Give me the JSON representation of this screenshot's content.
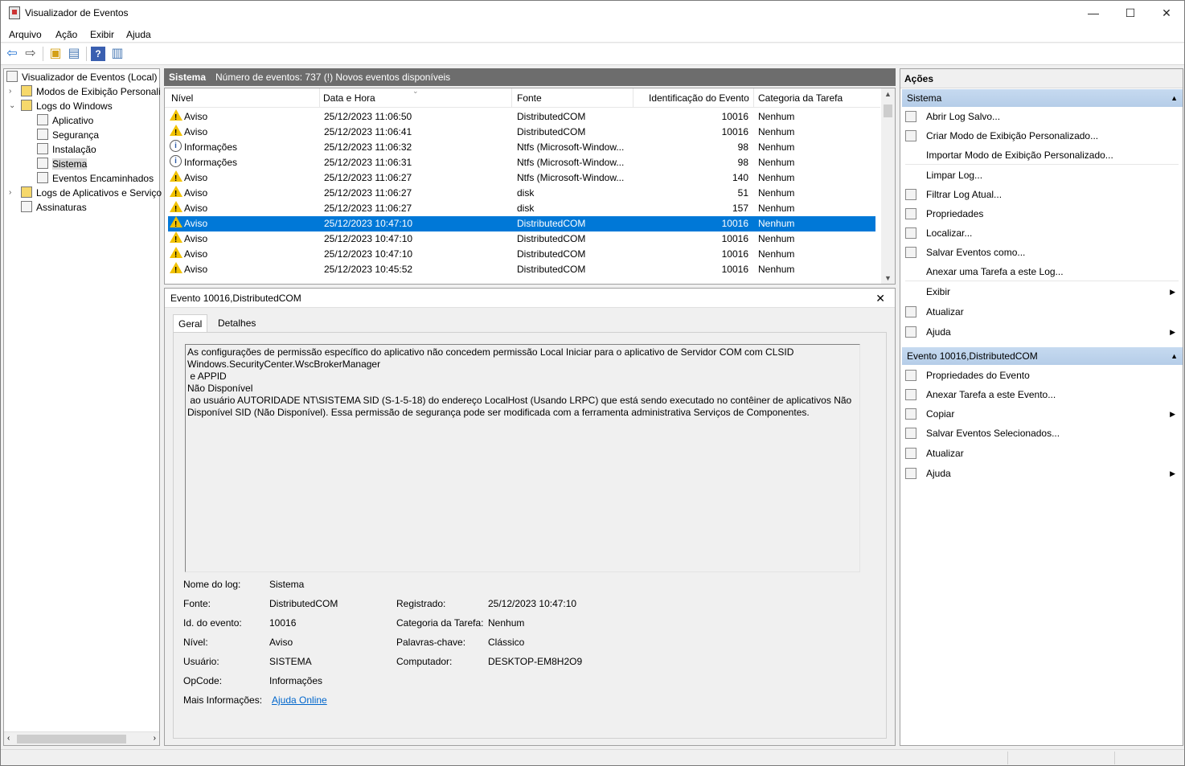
{
  "window": {
    "title": "Visualizador de Eventos",
    "minimize": "—",
    "maximize": "☐",
    "close": "✕"
  },
  "menu": [
    "Arquivo",
    "Ação",
    "Exibir",
    "Ajuda"
  ],
  "tree": {
    "root": "Visualizador de Eventos (Local)",
    "custom_views": "Modos de Exibição Personali",
    "windows_logs": "Logs do Windows",
    "application": "Aplicativo",
    "security": "Segurança",
    "setup": "Instalação",
    "system": "Sistema",
    "forwarded": "Eventos Encaminhados",
    "app_logs": "Logs de Aplicativos e Serviço",
    "subscriptions": "Assinaturas"
  },
  "log_header": {
    "name": "Sistema",
    "count_text": "Número de eventos: 737 (!) Novos eventos disponíveis"
  },
  "columns": [
    "Nível",
    "Data e Hora",
    "Fonte",
    "Identificação do Evento",
    "Categoria da Tarefa"
  ],
  "events": [
    {
      "level": "Aviso",
      "icon": "warning",
      "date": "25/12/2023 11:06:50",
      "source": "DistributedCOM",
      "id": "10016",
      "category": "Nenhum"
    },
    {
      "level": "Aviso",
      "icon": "warning",
      "date": "25/12/2023 11:06:41",
      "source": "DistributedCOM",
      "id": "10016",
      "category": "Nenhum"
    },
    {
      "level": "Informações",
      "icon": "info",
      "date": "25/12/2023 11:06:32",
      "source": "Ntfs (Microsoft-Window...",
      "id": "98",
      "category": "Nenhum"
    },
    {
      "level": "Informações",
      "icon": "info",
      "date": "25/12/2023 11:06:31",
      "source": "Ntfs (Microsoft-Window...",
      "id": "98",
      "category": "Nenhum"
    },
    {
      "level": "Aviso",
      "icon": "warning",
      "date": "25/12/2023 11:06:27",
      "source": "Ntfs (Microsoft-Window...",
      "id": "140",
      "category": "Nenhum"
    },
    {
      "level": "Aviso",
      "icon": "warning",
      "date": "25/12/2023 11:06:27",
      "source": "disk",
      "id": "51",
      "category": "Nenhum"
    },
    {
      "level": "Aviso",
      "icon": "warning",
      "date": "25/12/2023 11:06:27",
      "source": "disk",
      "id": "157",
      "category": "Nenhum"
    },
    {
      "level": "Aviso",
      "icon": "warning",
      "date": "25/12/2023 10:47:10",
      "source": "DistributedCOM",
      "id": "10016",
      "category": "Nenhum"
    },
    {
      "level": "Aviso",
      "icon": "warning",
      "date": "25/12/2023 10:47:10",
      "source": "DistributedCOM",
      "id": "10016",
      "category": "Nenhum"
    },
    {
      "level": "Aviso",
      "icon": "warning",
      "date": "25/12/2023 10:47:10",
      "source": "DistributedCOM",
      "id": "10016",
      "category": "Nenhum"
    },
    {
      "level": "Aviso",
      "icon": "warning",
      "date": "25/12/2023 10:45:52",
      "source": "DistributedCOM",
      "id": "10016",
      "category": "Nenhum"
    }
  ],
  "selected_row": 7,
  "detail": {
    "title": "Evento 10016,DistributedCOM",
    "tabs": [
      "Geral",
      "Detalhes"
    ],
    "message": "As configurações de permissão específico do aplicativo não concedem permissão Local Iniciar para o aplicativo de Servidor COM com CLSID \nWindows.SecurityCenter.WscBrokerManager\n e APPID \nNão Disponível\n ao usuário AUTORIDADE NT\\SISTEMA SID (S-1-5-18) do endereço LocalHost (Usando LRPC) que está sendo executado no contêiner de aplicativos Não Disponível SID (Não Disponível). Essa permissão de segurança pode ser modificada com a ferramenta administrativa Serviços de Componentes.",
    "fields": {
      "log_name_label": "Nome do log:",
      "log_name": "Sistema",
      "source_label": "Fonte:",
      "source": "DistributedCOM",
      "logged_label": "Registrado:",
      "logged": "25/12/2023 10:47:10",
      "event_id_label": "Id. do evento:",
      "event_id": "10016",
      "task_label": "Categoria da Tarefa:",
      "task": "Nenhum",
      "level_label": "Nível:",
      "level": "Aviso",
      "keywords_label": "Palavras-chave:",
      "keywords": "Clássico",
      "user_label": "Usuário:",
      "user": "SISTEMA",
      "computer_label": "Computador:",
      "computer": "DESKTOP-EM8H2O9",
      "opcode_label": "OpCode:",
      "opcode": "Informações",
      "more_label": "Mais Informações:",
      "more_link": "Ajuda Online"
    }
  },
  "actions": {
    "title": "Ações",
    "section1": "Sistema",
    "items1": [
      "Abrir Log Salvo...",
      "Criar Modo de Exibição Personalizado...",
      "Importar Modo de Exibição Personalizado...",
      "Limpar Log...",
      "Filtrar Log Atual...",
      "Propriedades",
      "Localizar...",
      "Salvar Eventos como...",
      "Anexar uma Tarefa a este Log...",
      "Exibir",
      "Atualizar",
      "Ajuda"
    ],
    "section2": "Evento 10016,DistributedCOM",
    "items2": [
      "Propriedades do Evento",
      "Anexar Tarefa a este Evento...",
      "Copiar",
      "Salvar Eventos Selecionados...",
      "Atualizar",
      "Ajuda"
    ]
  }
}
